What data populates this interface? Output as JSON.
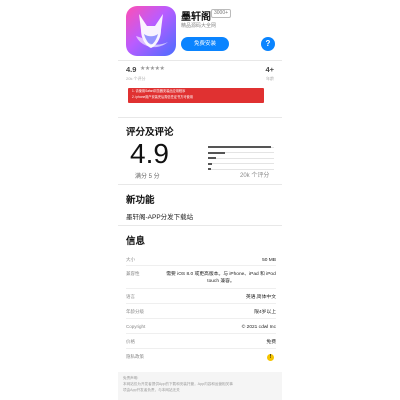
{
  "app": {
    "name": "墨轩阁",
    "badge": "3000+",
    "subtitle": "精品源码大全网",
    "install_label": "免费安装",
    "help_label": "?"
  },
  "summary": {
    "rating": "4.9",
    "stars": "★★★★★",
    "rating_count": "20k 个评分",
    "age": "4+",
    "age_label": "年龄"
  },
  "warning": {
    "lines": [
      "1. 请使用Safari浏览器安装此应用程序",
      "2. iphone用户安装完后需信任证书方可使用"
    ]
  },
  "ratings": {
    "title": "评分及评论",
    "score": "4.9",
    "out_of": "满分 5 分",
    "total": "20k 个评分",
    "distribution": [
      0.95,
      0.25,
      0.12,
      0.06,
      0.04
    ]
  },
  "new_features": {
    "title": "新功能",
    "text": "墨轩阁-APP分发下载站"
  },
  "info": {
    "title": "信息",
    "rows": [
      {
        "key": "大小",
        "value": "50 MB"
      },
      {
        "key": "兼容性",
        "value": "需要 iOS 8.0 或更高版本。与 iPhone、iPad 和 iPod touch 兼容。"
      },
      {
        "key": "语言",
        "value": "英语,简体中文"
      },
      {
        "key": "年龄分级",
        "value": "限4岁以上"
      },
      {
        "key": "Copyright",
        "value": "© 2021 cdwl Inc"
      },
      {
        "key": "价格",
        "value": "免费"
      },
      {
        "key": "隐私政策",
        "value": ""
      }
    ]
  },
  "footer": {
    "lines": [
      "免责声明:",
      "本网站仅为开发者提供App的下载和安装托管，App内容和运营相关事",
      "项由App开发者负责，与本网站无关"
    ]
  }
}
